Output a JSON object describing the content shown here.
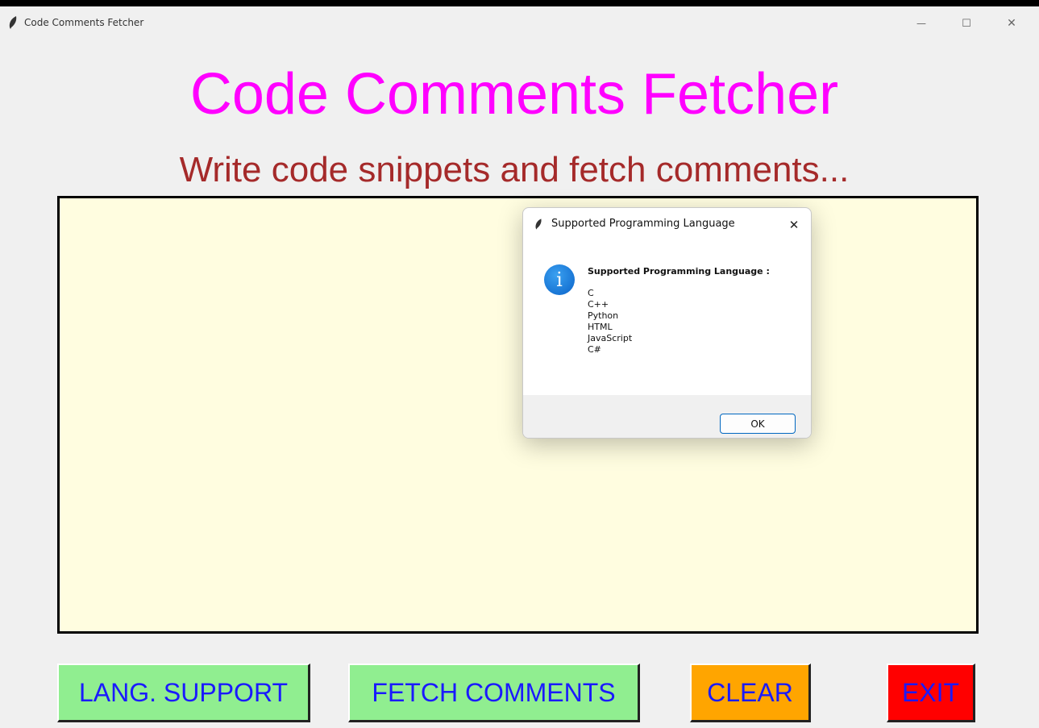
{
  "window": {
    "title": "Code Comments Fetcher",
    "controls": {
      "minimize": "—",
      "maximize": "☐",
      "close": "✕"
    }
  },
  "header": {
    "title": "Code Comments Fetcher",
    "subtitle": "Write code snippets and fetch comments..."
  },
  "editor": {
    "value": ""
  },
  "buttons": {
    "lang_support": "LANG. SUPPORT",
    "fetch_comments": "FETCH COMMENTS",
    "clear": "CLEAR",
    "exit": "EXIT"
  },
  "dialog": {
    "title": "Supported Programming Language",
    "close": "✕",
    "icon": "info-icon",
    "heading": "Supported Programming Language :",
    "languages": [
      "C",
      "C++",
      "Python",
      "HTML",
      "JavaScript",
      "C#"
    ],
    "ok_label": "OK"
  },
  "colors": {
    "title": "#ff00ff",
    "subtitle": "#a52a2a",
    "editor_bg": "#fffde0",
    "btn_green": "#90ee90",
    "btn_orange": "#ffa500",
    "btn_red": "#ff0000",
    "btn_text": "#1a1aff"
  }
}
